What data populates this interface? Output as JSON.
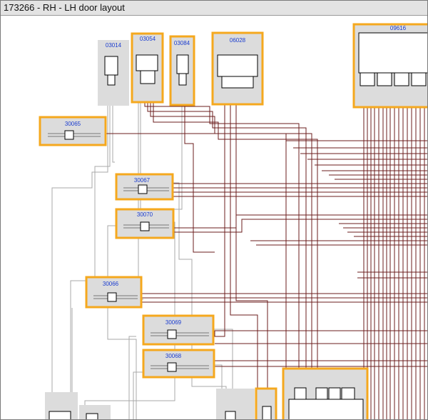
{
  "window": {
    "title": "173266 - RH - LH door layout"
  },
  "colors": {
    "highlight": "#f5a81e",
    "component_fill": "#dcdcdc",
    "wire_primary": "#6b1d1d",
    "wire_secondary": "#a8a8a8",
    "label": "#1a3ccf"
  },
  "components": {
    "c03014": "03014",
    "c03054": "03054",
    "c03084": "03084",
    "c06028": "06028",
    "c09616": "09616",
    "c30065": "30065",
    "c30067": "30067",
    "c30070": "30070",
    "c30066": "30066",
    "c30069": "30069",
    "c30068": "30068"
  }
}
